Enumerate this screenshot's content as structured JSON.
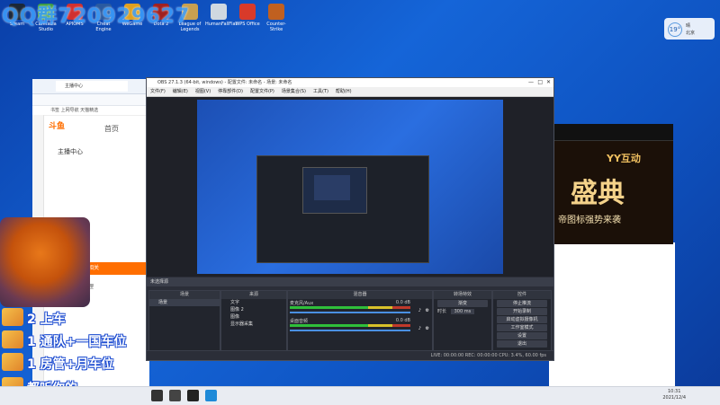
{
  "overlay": {
    "qq_text": "QQ群720929627"
  },
  "desktop_icons": [
    {
      "label": "Steam",
      "color": "#1b2838"
    },
    {
      "label": "Camtasia Studio",
      "color": "#3a9a44"
    },
    {
      "label": "APIOMS",
      "color": "#d03030"
    },
    {
      "label": "Cheat Engine",
      "color": "#2a5aa0"
    },
    {
      "label": "WeGame",
      "color": "#e0a020"
    },
    {
      "label": "Dota 2",
      "color": "#a02020"
    },
    {
      "label": "League of Legends",
      "color": "#c8a050"
    },
    {
      "label": "HumanFallFlat",
      "color": "#cfd8e0"
    },
    {
      "label": "WPS Office",
      "color": "#d83a2a"
    },
    {
      "label": "Counter-Strike",
      "color": "#c06020"
    }
  ],
  "weather": {
    "temp": "19°",
    "line1": "晴",
    "line2": "北京"
  },
  "browser": {
    "tab": "主播中心",
    "bookmarks": "书签  上网导航  天猫精选",
    "logo": "斗鱼",
    "home": "首页",
    "menu_1": "主播中心",
    "menu_2": "直播相关",
    "menu_3": "房间管理"
  },
  "banner": {
    "t1": "YY互动",
    "t2": "盛典",
    "t3": "帝图标强势来袭"
  },
  "obs": {
    "title": "OBS 27.1.3 (64-bit, windows) - 配置文件: 未命名 - 场景: 未命名",
    "menu": [
      "文件(F)",
      "编辑(E)",
      "视图(V)",
      "停靠部件(D)",
      "配置文件(P)",
      "场景集合(S)",
      "工具(T)",
      "帮助(H)"
    ],
    "scene_label": "未选择源",
    "panels": {
      "scenes": "场景",
      "sources": "来源",
      "mixer": "混音器",
      "transitions": "转场特效",
      "controls": "控件"
    },
    "scene_item": "场景",
    "sources_items": [
      "文字",
      "图像 2",
      "图像",
      "显示器采集"
    ],
    "mixer_rows": [
      {
        "name": "麦克风/Aux",
        "db": "0.0 dB"
      },
      {
        "name": "桌面音频",
        "db": "0.0 dB"
      }
    ],
    "transition_value": "渐变",
    "duration_label": "时长",
    "duration_value": "300 ms",
    "controls": [
      "停止推流",
      "开始录制",
      "启动虚拟摄像机",
      "工作室模式",
      "设置",
      "退出"
    ],
    "status": "LIVE: 00:00:00   REC: 00:00:00   CPU: 3.4%, 60.00 fps"
  },
  "chat": [
    {
      "text": "2  上车"
    },
    {
      "text": "1  通队+一国车位"
    },
    {
      "text": "1  房管+月车位"
    },
    {
      "text": "都听你的"
    }
  ],
  "taskbar": {
    "time": "10:31",
    "date": "2021/12/4"
  }
}
